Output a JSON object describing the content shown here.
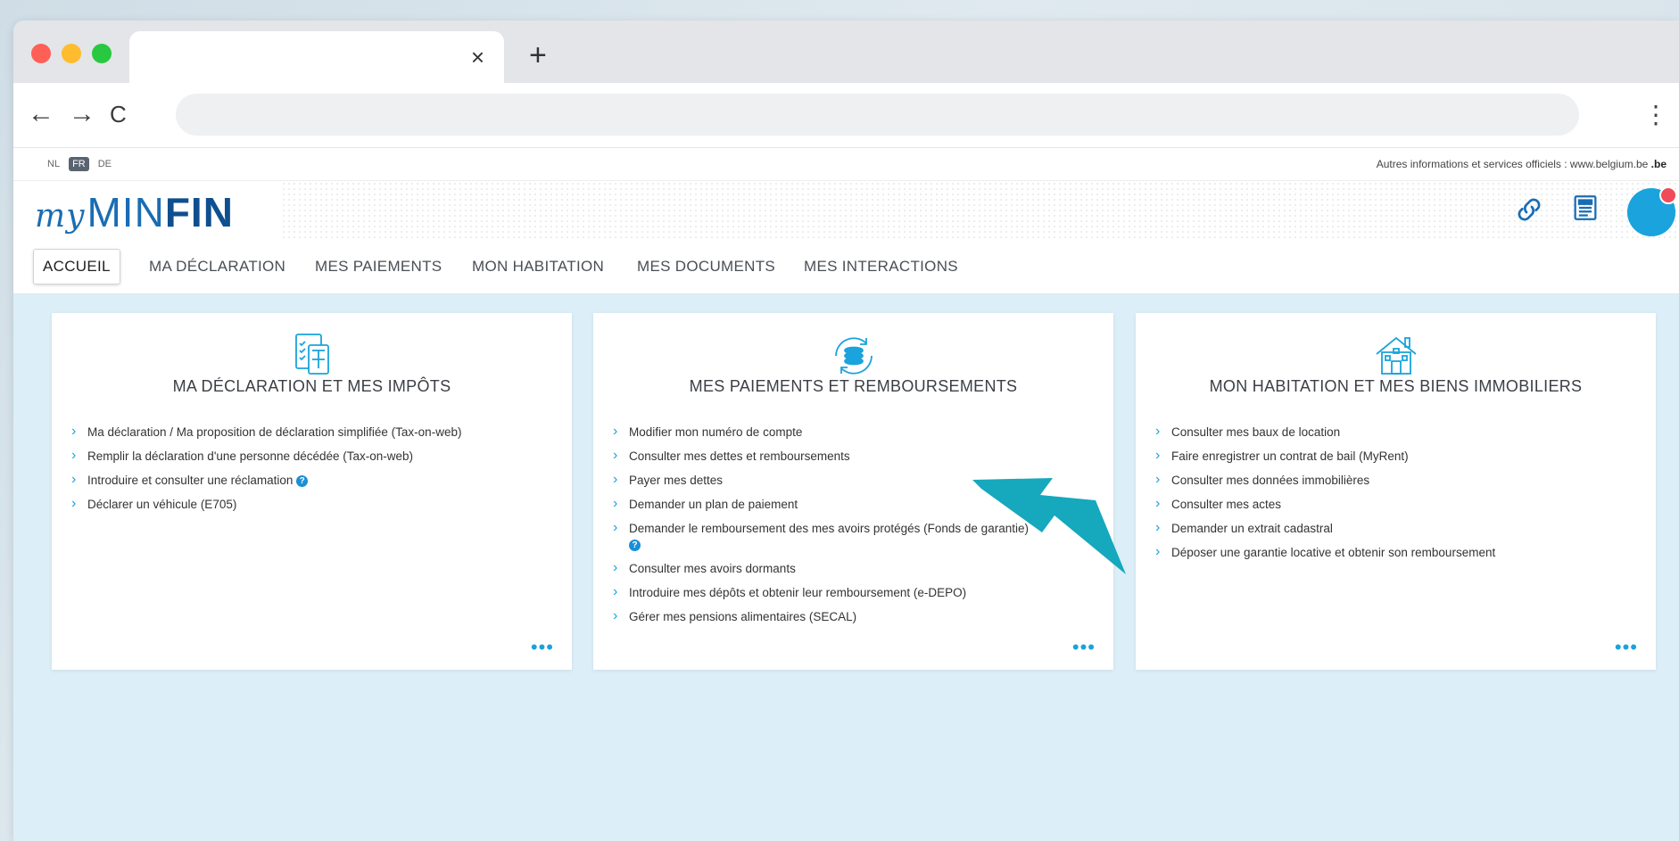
{
  "browser": {
    "tab_close": "×",
    "new_tab": "+",
    "back": "←",
    "forward": "→",
    "reload": "C",
    "menu": "⋮"
  },
  "site_top": {
    "languages": [
      "NL",
      "FR",
      "DE"
    ],
    "active_language": "FR",
    "official_text": "Autres informations et services officiels : www.belgium.be",
    "be_logo": ".be"
  },
  "header": {
    "logo_my": "my",
    "logo_min": "MIN",
    "logo_fin": "FIN",
    "icons": [
      "link-icon",
      "news-icon",
      "avatar"
    ]
  },
  "nav": {
    "items": [
      "ACCUEIL",
      "MA DÉCLARATION",
      "MES PAIEMENTS",
      "MON HABITATION",
      "MES DOCUMENTS",
      "MES INTERACTIONS"
    ],
    "active": "ACCUEIL"
  },
  "cards": [
    {
      "title": "MA DÉCLARATION ET MES IMPÔTS",
      "icon": "tax-form-icon",
      "links": [
        "Ma déclaration / Ma proposition de déclaration simplifiée (Tax-on-web)",
        "Remplir la déclaration d'une personne décédée (Tax-on-web)",
        "Introduire et consulter une réclamation",
        "Déclarer un véhicule (E705)"
      ],
      "more": "•••"
    },
    {
      "title": "MES PAIEMENTS ET REMBOURSEMENTS",
      "icon": "coins-icon",
      "links": [
        "Modifier mon numéro de compte",
        "Consulter mes dettes et remboursements",
        "Payer mes dettes",
        "Demander un plan de paiement",
        "Demander le remboursement des mes avoirs protégés (Fonds de garantie)",
        "Consulter mes avoirs dormants",
        "Introduire mes dépôts et obtenir leur remboursement (e-DEPO)",
        "Gérer mes pensions alimentaires (SECAL)"
      ],
      "more": "•••"
    },
    {
      "title": "MON HABITATION ET MES BIENS IMMOBILIERS",
      "icon": "house-icon",
      "links": [
        "Consulter mes baux de location",
        "Faire enregistrer un contrat de bail (MyRent)",
        "Consulter mes données immobilières",
        "Consulter mes actes",
        "Demander un extrait cadastral",
        "Déposer une garantie locative et obtenir son remboursement"
      ],
      "more": "•••"
    }
  ],
  "colors": {
    "accent": "#1aa3dc",
    "brand": "#1a6db3",
    "arrow": "#16a8bd",
    "page_bg": "#dceef7"
  }
}
